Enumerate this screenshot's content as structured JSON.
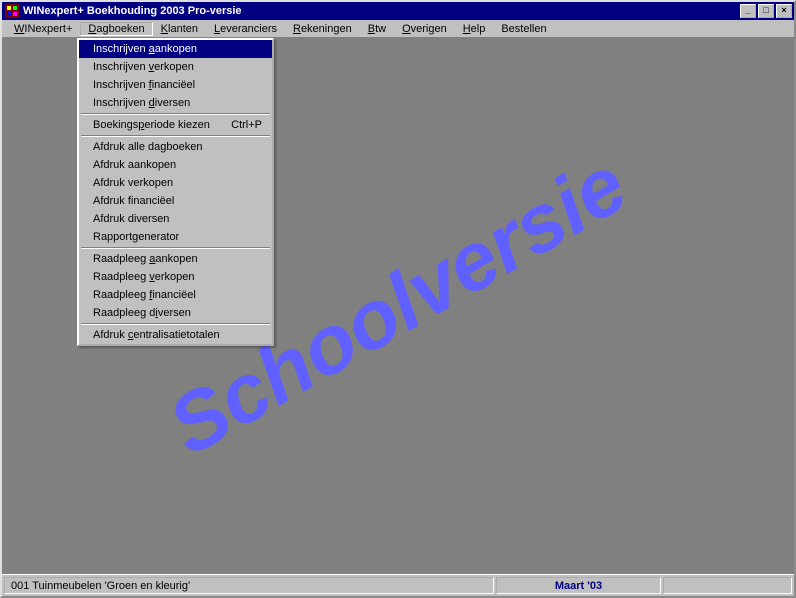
{
  "window": {
    "title": "WINexpert+ Boekhouding 2003 Pro-versie"
  },
  "menubar": {
    "items": [
      {
        "label": "WINexpert+",
        "u": 0
      },
      {
        "label": "Dagboeken",
        "u": 0
      },
      {
        "label": "Klanten",
        "u": 0
      },
      {
        "label": "Leveranciers",
        "u": 0
      },
      {
        "label": "Rekeningen",
        "u": 0
      },
      {
        "label": "Btw",
        "u": 0
      },
      {
        "label": "Overigen",
        "u": 0
      },
      {
        "label": "Help",
        "u": 0
      },
      {
        "label": "Bestellen",
        "u": -1
      }
    ],
    "open_index": 1
  },
  "dropdown": {
    "groups": [
      [
        {
          "label": "Inschrijven aankopen",
          "u": 12,
          "shortcut": "",
          "highlight": true
        },
        {
          "label": "Inschrijven verkopen",
          "u": 12,
          "shortcut": ""
        },
        {
          "label": "Inschrijven financiëel",
          "u": 12,
          "shortcut": ""
        },
        {
          "label": "Inschrijven diversen",
          "u": 12,
          "shortcut": ""
        }
      ],
      [
        {
          "label": "Boekingsperiode kiezen",
          "u": 8,
          "shortcut": "Ctrl+P"
        }
      ],
      [
        {
          "label": "Afdruk alle dagboeken",
          "u": -1,
          "shortcut": ""
        },
        {
          "label": "Afdruk aankopen",
          "u": -1,
          "shortcut": ""
        },
        {
          "label": "Afdruk verkopen",
          "u": -1,
          "shortcut": ""
        },
        {
          "label": "Afdruk financiëel",
          "u": -1,
          "shortcut": ""
        },
        {
          "label": "Afdruk diversen",
          "u": -1,
          "shortcut": ""
        },
        {
          "label": "Rapportgenerator",
          "u": -1,
          "shortcut": ""
        }
      ],
      [
        {
          "label": "Raadpleeg aankopen",
          "u": 10,
          "shortcut": ""
        },
        {
          "label": "Raadpleeg verkopen",
          "u": 10,
          "shortcut": ""
        },
        {
          "label": "Raadpleeg financiëel",
          "u": 10,
          "shortcut": ""
        },
        {
          "label": "Raadpleeg diversen",
          "u": 11,
          "shortcut": ""
        }
      ],
      [
        {
          "label": "Afdruk centralisatietotalen",
          "u": 7,
          "shortcut": ""
        }
      ]
    ]
  },
  "watermark": "Schoolversie",
  "statusbar": {
    "left": "001 Tuinmeubelen 'Groen en kleurig'",
    "mid": "Maart '03",
    "right": ""
  }
}
